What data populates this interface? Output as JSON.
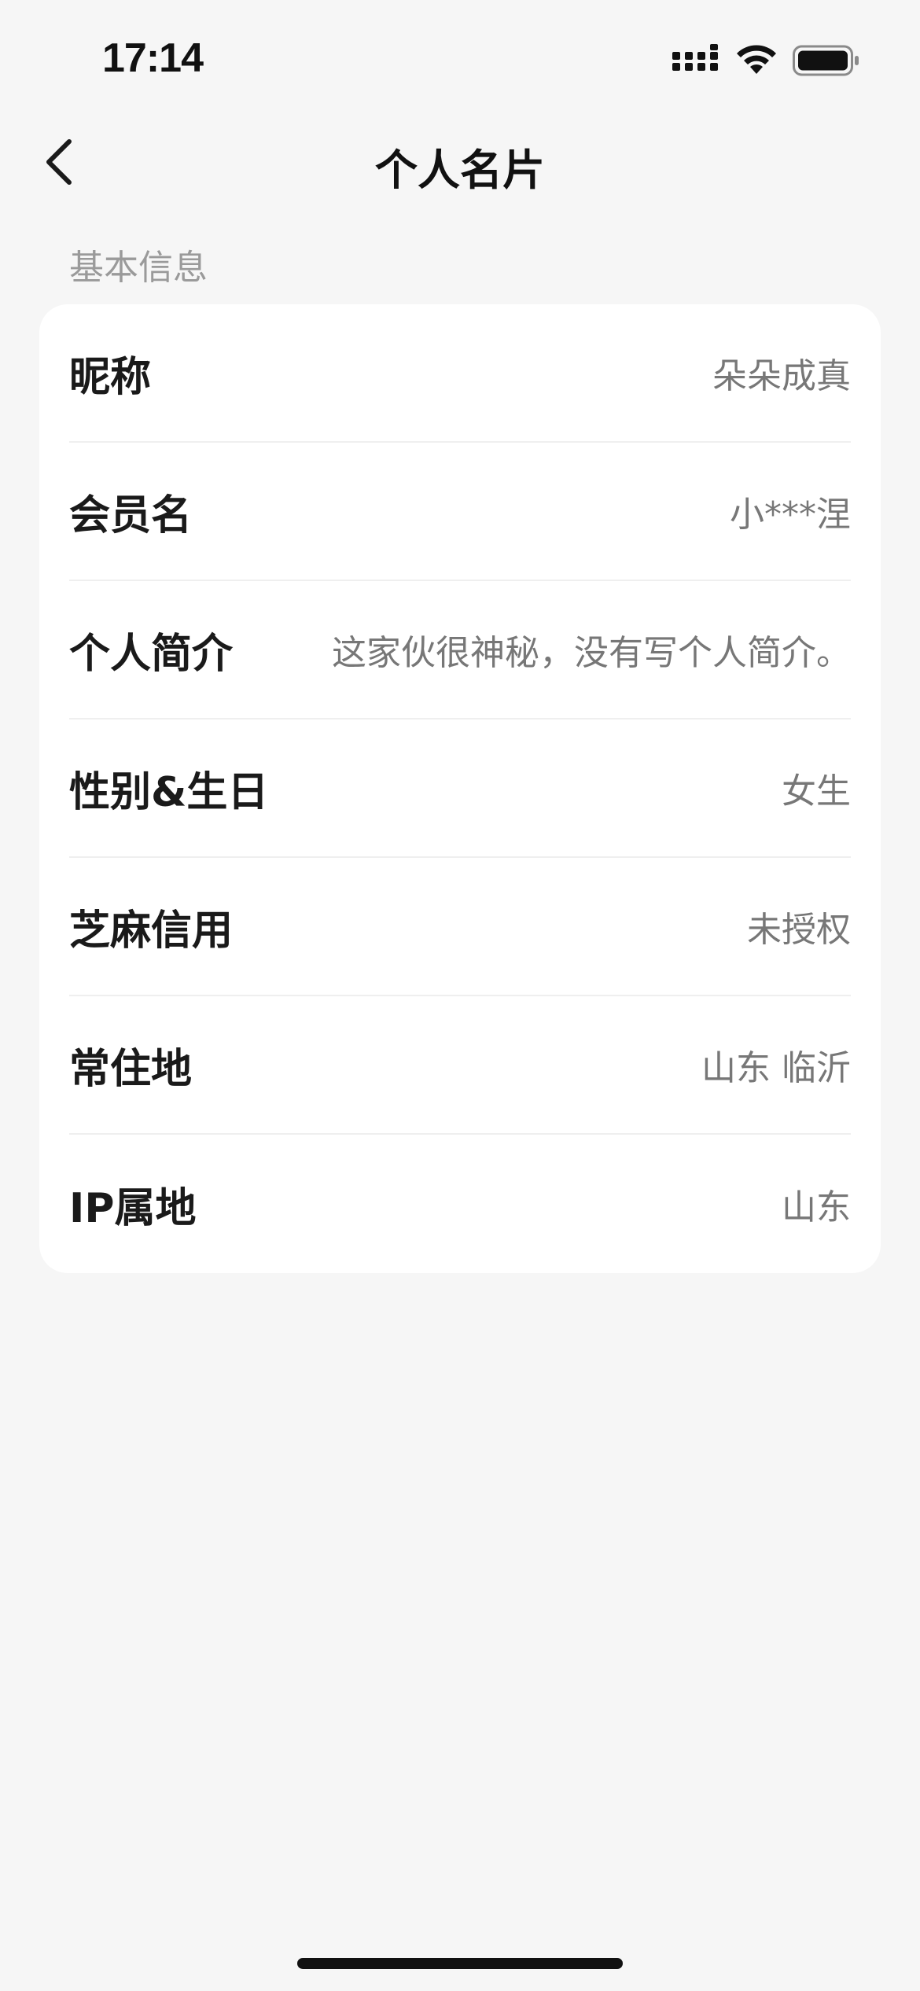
{
  "status_bar": {
    "time": "17:14",
    "icons": [
      "cellular-signal-icon",
      "wifi-icon",
      "battery-icon"
    ]
  },
  "nav": {
    "back_icon": "chevron-left-icon",
    "title": "个人名片"
  },
  "section": {
    "header": "基本信息"
  },
  "rows": [
    {
      "label": "昵称",
      "value": "朵朵成真"
    },
    {
      "label": "会员名",
      "value": "小***涅"
    },
    {
      "label": "个人简介",
      "value": "这家伙很神秘，没有写个人简介。"
    },
    {
      "label": "性别&生日",
      "value": "女生"
    },
    {
      "label": "芝麻信用",
      "value": "未授权"
    },
    {
      "label": "常住地",
      "value": "山东 临沂"
    },
    {
      "label": "IP属地",
      "value": "山东"
    }
  ],
  "colors": {
    "background": "#f6f6f6",
    "card": "#ffffff",
    "label_text": "#1a1a1a",
    "value_text": "#777777",
    "section_header": "#9a9a9a",
    "divider": "#efefef"
  }
}
